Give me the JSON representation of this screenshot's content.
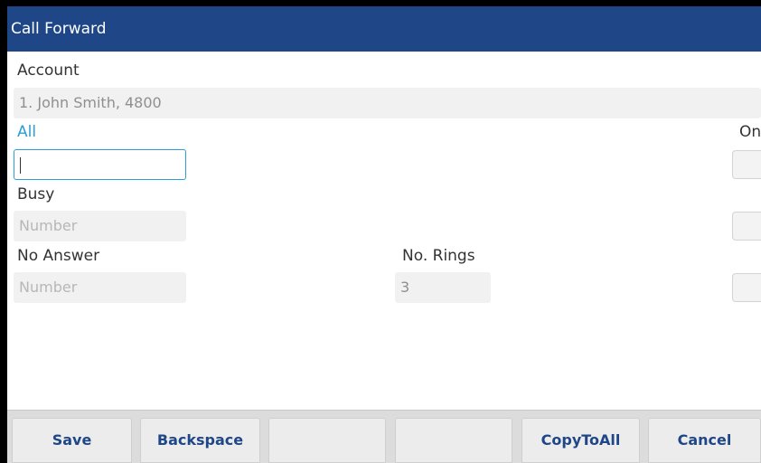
{
  "title": "Call Forward",
  "account": {
    "label": "Account",
    "value": "1. John Smith, 4800"
  },
  "forward_all": {
    "label": "All",
    "value": ""
  },
  "on_label": "On",
  "forward_busy": {
    "label": "Busy",
    "placeholder": "Number"
  },
  "forward_no_answer": {
    "label": "No Answer",
    "placeholder": "Number"
  },
  "no_rings": {
    "label": "No. Rings",
    "value": "3"
  },
  "softkeys": [
    "Save",
    "Backspace",
    "",
    "",
    "CopyToAll",
    "Cancel"
  ],
  "colors": {
    "header": "#1f4788",
    "accent": "#2b9fd6"
  }
}
